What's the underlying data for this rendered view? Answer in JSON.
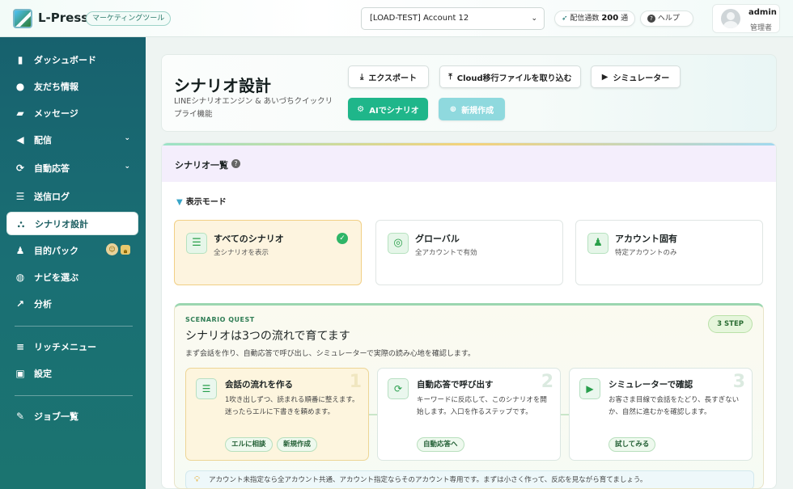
{
  "app": {
    "brand": "L-Press",
    "tag": "マーケティングツール"
  },
  "topbar": {
    "account_select": "[LOAD-TEST] Account 12",
    "delivery_label": "配信通数",
    "delivery_count": "200",
    "delivery_unit": "通",
    "help_label": "ヘルプ",
    "user_name": "admin",
    "user_role": "管理者"
  },
  "sidebar": {
    "items": [
      {
        "label": "ダッシュボード",
        "icon": "bar-chart-icon"
      },
      {
        "label": "友だち情報",
        "icon": "users-icon"
      },
      {
        "label": "メッセージ",
        "icon": "chat-icon"
      },
      {
        "label": "配信",
        "icon": "megaphone-icon"
      },
      {
        "label": "自動応答",
        "icon": "sync-icon"
      },
      {
        "label": "送信ログ",
        "icon": "list-icon"
      },
      {
        "label": "シナリオ設計",
        "icon": "sitemap-icon"
      },
      {
        "label": "目的パック",
        "icon": "person-icon"
      },
      {
        "label": "ナビを選ぶ",
        "icon": "comment-icon"
      },
      {
        "label": "分析",
        "icon": "line-chart-icon"
      },
      {
        "label": "リッチメニュー",
        "icon": "menu-icon"
      },
      {
        "label": "設定",
        "icon": "settings-icon"
      },
      {
        "label": "ジョブ一覧",
        "icon": "pen-icon"
      }
    ]
  },
  "header": {
    "title": "シナリオ設計",
    "subtitle": "LINEシナリオエンジン & あいづちクイックリプライ機能",
    "export_label": "エクスポート",
    "import_label": "Cloud移行ファイルを取り込む",
    "simulator_label": "シミュレーター",
    "ai_label": "AIでシナリオ",
    "new_label": "新規作成"
  },
  "list": {
    "title": "シナリオ一覧",
    "mode_label": "表示モード",
    "modes": [
      {
        "title": "すべてのシナリオ",
        "desc": "全シナリオを表示"
      },
      {
        "title": "グローバル",
        "desc": "全アカウントで有効"
      },
      {
        "title": "アカウント固有",
        "desc": "特定アカウントのみ"
      }
    ]
  },
  "quest": {
    "kicker": "SCENARIO QUEST",
    "title": "シナリオは3つの流れで育てます",
    "desc": "まず会話を作り、自動応答で呼び出し、シミュレーターで実際の読み心地を確認します。",
    "badge": "3 STEP",
    "steps": [
      {
        "title": "会話の流れを作る",
        "num": "1",
        "desc": "1吹き出しずつ、読まれる順番に整えます。迷ったらエルに下書きを頼めます。",
        "chips": [
          "エルに相談",
          "新規作成"
        ]
      },
      {
        "title": "自動応答で呼び出す",
        "num": "2",
        "desc": "キーワードに反応して、このシナリオを開始します。入口を作るステップです。",
        "chips": [
          "自動応答へ"
        ]
      },
      {
        "title": "シミュレーターで確認",
        "num": "3",
        "desc": "お客さま目線で会話をたどり、長すぎないか、自然に進むかを確認します。",
        "chips": [
          "試してみる"
        ]
      }
    ],
    "tip": "アカウント未指定なら全アカウント共通、アカウント指定ならそのアカウント専用です。まずは小さく作って、反応を見ながら育てましょう。"
  },
  "colors": {
    "sidebar": "#1a6f74",
    "accent": "#1fb68a",
    "active_text": "#1d5f62"
  }
}
